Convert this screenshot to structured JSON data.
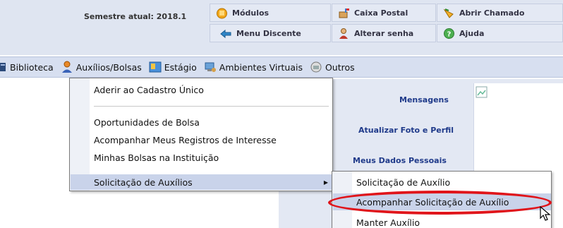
{
  "header": {
    "semester": "Semestre atual: 2018.1",
    "modulos": "Módulos",
    "caixa_postal": "Caixa Postal",
    "abrir_chamado": "Abrir Chamado",
    "menu_discente": "Menu Discente",
    "alterar_senha": "Alterar senha",
    "ajuda": "Ajuda"
  },
  "menubar": {
    "biblioteca": "Biblioteca",
    "auxilios": "Auxílios/Bolsas",
    "estagio": "Estágio",
    "ambientes": "Ambientes Virtuais",
    "outros": "Outros"
  },
  "dropdown": {
    "items": [
      "Aderir ao Cadastro Único",
      "Oportunidades de Bolsa",
      "Acompanhar Meus Registros de Interesse",
      "Minhas Bolsas na Instituição",
      "Solicitação de Auxílios"
    ]
  },
  "submenu": {
    "items": [
      "Solicitação de Auxílio",
      "Acompanhar Solicitação de Auxílio",
      "Manter Auxílio"
    ]
  },
  "panel": {
    "mensagens": "Mensagens",
    "atualizar_foto": "Atualizar Foto e Perfil",
    "meus_dados": "Meus Dados Pessoais"
  },
  "colors": {
    "header_bg": "#dfe5f1",
    "menubar_bg": "#d7dff0",
    "active_bg": "#c9d3ea",
    "highlight_ring": "#e0141a",
    "link": "#1f3a8a"
  }
}
